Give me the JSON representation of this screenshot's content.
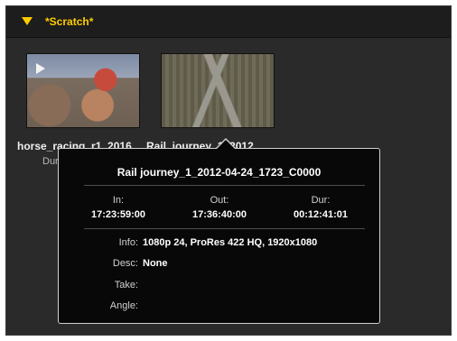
{
  "bin": {
    "title": "*Scratch*"
  },
  "clips": [
    {
      "name": "horse_racing_r1_2016",
      "duration": "Dur"
    },
    {
      "name": "Rail_journey_1_2012",
      "duration": ""
    }
  ],
  "popup": {
    "title": "Rail journey_1_2012-04-24_1723_C0000",
    "in_label": "In:",
    "in_value": "17:23:59:00",
    "out_label": "Out:",
    "out_value": "17:36:40:00",
    "dur_label": "Dur:",
    "dur_value": "00:12:41:01",
    "info_label": "Info:",
    "info_value": "1080p 24, ProRes 422 HQ, 1920x1080",
    "desc_label": "Desc:",
    "desc_value": "None",
    "take_label": "Take:",
    "take_value": "",
    "angle_label": "Angle:",
    "angle_value": ""
  },
  "icons": {
    "bin_toggle": "triangle-down-icon",
    "clip_play": "play-icon"
  },
  "colors": {
    "accent": "#ffcc00",
    "panel": "#2a2a2a",
    "popup": "#080808"
  }
}
